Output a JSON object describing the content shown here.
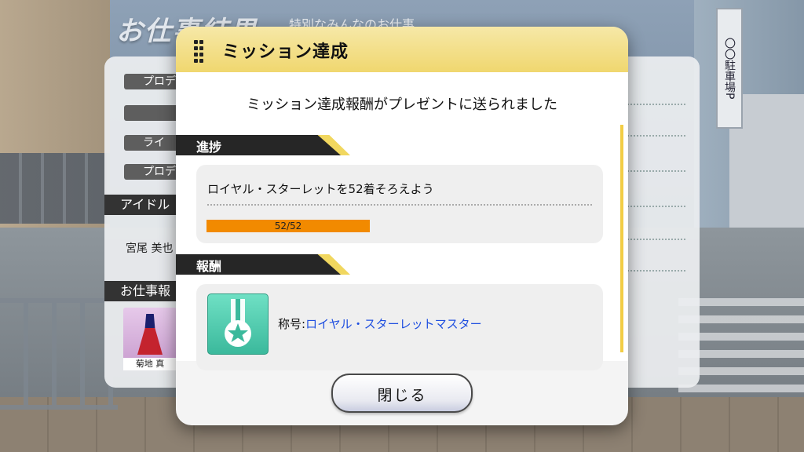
{
  "background": {
    "screen_title": "お仕事結果",
    "screen_subtitle": "特別なみんなのお仕事",
    "panel": {
      "pill_labels": [
        "プロデ",
        "",
        "ライ",
        "プロデ"
      ],
      "section_idol": "アイドル",
      "idol_name": "宮尾 美也",
      "section_work": "お仕事報",
      "item_caption": "菊地 真"
    },
    "sign_text": "〇〇駐車場P"
  },
  "modal": {
    "title": "ミッション達成",
    "message": "ミッション達成報酬がプレゼントに送られました",
    "progress_section": {
      "heading": "進捗",
      "mission_name": "ロイヤル・スターレットを52着そろえよう",
      "progress_text": "52/52",
      "progress_fraction": 1.0
    },
    "reward_section": {
      "heading": "報酬",
      "reward_prefix": "称号:",
      "reward_name": "ロイヤル・スターレットマスター",
      "reward_icon": "medal-star-icon"
    },
    "close_label": "閉じる"
  },
  "colors": {
    "header_gold": "#f0d76f",
    "progress_orange": "#f28a00",
    "reward_link_blue": "#1f4fe0",
    "medal_teal": "#3bb99c"
  }
}
